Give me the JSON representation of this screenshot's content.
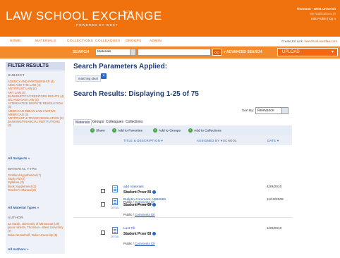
{
  "header": {
    "logo": "LAW SCHOOL EXCHANGE",
    "beta": "BETA",
    "powered": "POWERED BY WEST",
    "user_name": "Thomson - West Universit",
    "notifications": "My Notifications (0",
    "edit_profile": "Edit Profile | log o"
  },
  "nav": {
    "items": [
      "HOME",
      "MATERIALS",
      "COLLECTIONS",
      "COLLEAGUES",
      "GROUPS",
      "ADMIN"
    ],
    "right_text": "Create Ed Link",
    "right_link": "lawschool.westlaw.com"
  },
  "search": {
    "label": "SEARCH",
    "scope": "Materials",
    "query": "",
    "go": "GO",
    "advanced": "ADVANCED SEARCH",
    "upload": "UPLOAD",
    "colors": {
      "bar": "#f38a2c",
      "header": "#f0720f"
    }
  },
  "sidebar": {
    "title": "FILTER RESULTS",
    "subject_head": "SUBJECT",
    "subjects": [
      "AGENCY AND PARTNERSHIP (4)",
      "AIDS AND THE LAW (4)",
      "ANTITRUST LAW (4)",
      "ART LAW (4)",
      "BANKRUPTCY/CREDITORS RIGHTS (4)",
      "OIL AND GAS LAW (4)",
      "ALTERNATIVE DISPUTE RESOLUTION (3)",
      "AMERICAN INDIAN LAW / NATIVE AMERICAN (3)",
      "ANTITRUST & TRADE REGULATION (3)",
      "BANKING/FINANCIAL INSTITUTIONS (3)"
    ],
    "all_subjects": "All Subjects »",
    "material_head": "MATERIAL TYPE",
    "materials": [
      "Problem/Hypothetical (7)",
      "Study Aid (4)",
      "Syllabus (3)",
      "Book Supplement (2)",
      "Teacher's Manual (2)"
    ],
    "all_materials": "All Material Types »",
    "author_head": "AUTHOR",
    "authors": [
      "aa Sarah, University of Minnesota (19)",
      "jason roberts, Thomson - West University (7)",
      "Duke Nesselhoff, Duke University (6)"
    ],
    "all_authors": "All Authors »"
  },
  "main": {
    "params_title": "Search Parameters Applied:",
    "param_chip": "matching ideal",
    "results_title": "Search Results: Displaying 1-25 of 75",
    "sort_label": "Sort By:",
    "sort_value": "Relevance",
    "tabs": [
      "Materials",
      "Groups",
      "Colleagues",
      "Collections"
    ],
    "actions": [
      "Share",
      "Add to Favorites",
      "Add to Groups",
      "Add to Collections"
    ],
    "columns": {
      "title": "TITLE & DESCRIPTION ▾",
      "assigned": "ASSIGNED BY ▾",
      "school": "SCHOOL",
      "date": "DATE ▾"
    },
    "rows": [
      {
        "title": "add materials",
        "author": "Student Prxer Bl",
        "public": "Public /",
        "comments": "Comments (0)",
        "date": "4/29/2010",
        "detail": "DETAIL"
      },
      {
        "title": "Bulletin Commack ABB0666",
        "author": "Student Prxer Bl",
        "public": "Public /",
        "comments": "Comments (0)",
        "date": "11/10/2009",
        "detail": "DETAIL"
      },
      {
        "title": "Last Tilt",
        "author": "Student Prxer Bl",
        "public": "Public /",
        "comments": "Comments (0)",
        "date": "1/29/2010",
        "detail": "DETAIL"
      }
    ]
  }
}
